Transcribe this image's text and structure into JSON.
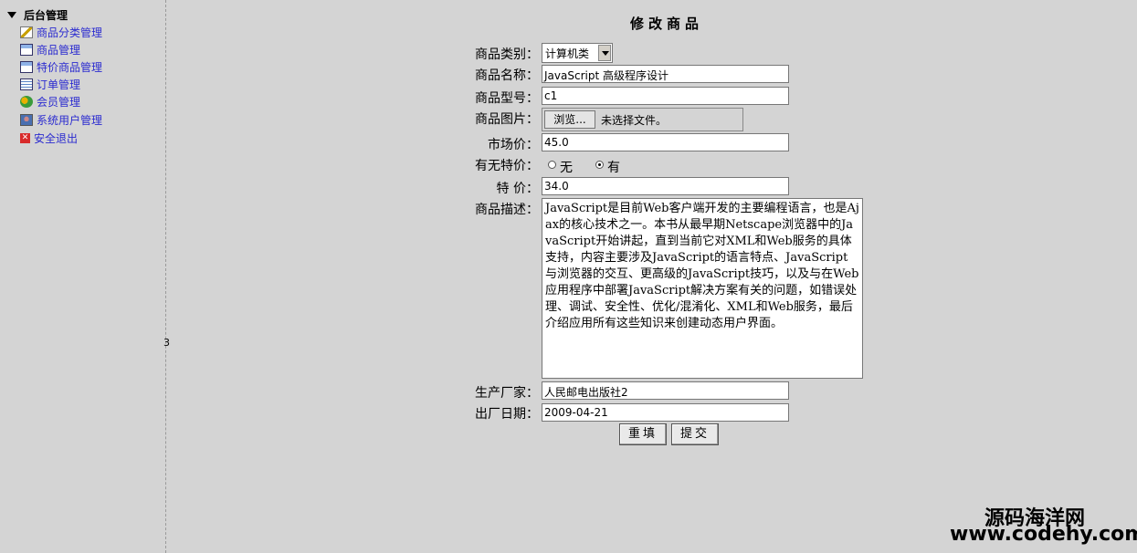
{
  "sidebar": {
    "root_label": "后台管理",
    "items": [
      {
        "label": "商品分类管理",
        "icon": "pencil-icon"
      },
      {
        "label": "商品管理",
        "icon": "chart-window-icon"
      },
      {
        "label": "特价商品管理",
        "icon": "chart-window-icon"
      },
      {
        "label": "订单管理",
        "icon": "list-icon"
      },
      {
        "label": "会员管理",
        "icon": "people-icon"
      },
      {
        "label": "系统用户管理",
        "icon": "user-icon"
      },
      {
        "label": "安全退出",
        "icon": "exit-icon"
      }
    ]
  },
  "splitter_label": "3",
  "form": {
    "title": "修改商品",
    "category": {
      "label": "商品类别：",
      "value": "计算机类"
    },
    "name": {
      "label": "商品名称：",
      "value": "JavaScript 高级程序设计"
    },
    "model": {
      "label": "商品型号：",
      "value": "c1"
    },
    "image": {
      "label": "商品图片：",
      "button": "浏览...",
      "status": "未选择文件。"
    },
    "market_price": {
      "label": "市场价：",
      "value": "45.0"
    },
    "special": {
      "label": "有无特价：",
      "option_no": "无",
      "option_yes": "有",
      "selected": "有"
    },
    "special_price": {
      "label": "特 价：",
      "value": "34.0"
    },
    "description": {
      "label": "商品描述：",
      "value": "JavaScript是目前Web客户端开发的主要编程语言，也是Ajax的核心技术之一。本书从最早期Netscape浏览器中的JavaScript开始讲起，直到当前它对XML和Web服务的具体支持，内容主要涉及JavaScript的语言特点、JavaScript与浏览器的交互、更高级的JavaScript技巧，以及与在Web应用程序中部署JavaScript解决方案有关的问题，如错误处理、调试、安全性、优化/混淆化、XML和Web服务，最后介绍应用所有这些知识来创建动态用户界面。"
    },
    "manufacturer": {
      "label": "生产厂家：",
      "value": "人民邮电出版社2"
    },
    "date": {
      "label": "出厂日期：",
      "value": "2009-04-21"
    },
    "reset_button": "重填",
    "submit_button": "提交"
  },
  "watermark": {
    "cn": "源码海洋网",
    "en": "www.codehy.com"
  }
}
